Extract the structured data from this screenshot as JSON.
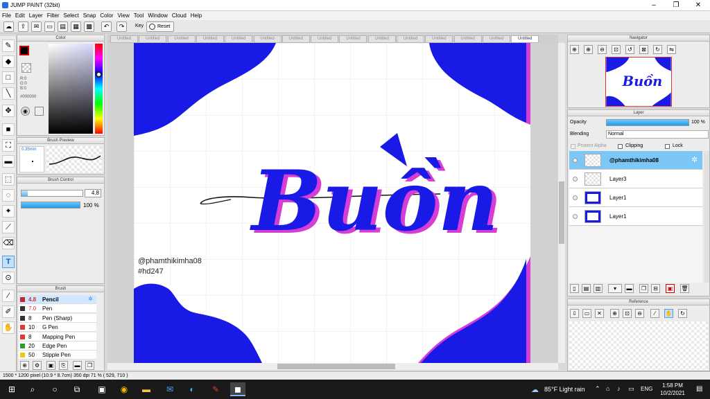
{
  "window": {
    "title": "JUMP PAINT (32bit)"
  },
  "menu": [
    "File",
    "Edit",
    "Layer",
    "Filter",
    "Select",
    "Snap",
    "Color",
    "View",
    "Tool",
    "Window",
    "Cloud",
    "Help"
  ],
  "toolbar": {
    "key_label": "Key",
    "reset_label": "Reset"
  },
  "tabs": [
    "Untitled",
    "Untitled",
    "Untitled",
    "Untitled",
    "Untitled",
    "Untitled",
    "Untitled",
    "Untitled",
    "Untitled",
    "Untitled",
    "Untitled",
    "Untitled",
    "Untitled",
    "Untitled",
    "Untitled"
  ],
  "color_panel": {
    "title": "Color",
    "r": "R:0",
    "g": "G:0",
    "b": "B:0",
    "hex": "#000000"
  },
  "brush_preview": {
    "title": "Brush Preview",
    "size": "0.35mm"
  },
  "brush_control": {
    "title": "Brush Control",
    "size_value": "4.8",
    "opacity_value": "100 %",
    "opacity_fraction": 1.0,
    "size_fraction": 0.1
  },
  "brush_panel": {
    "title": "Brush",
    "items": [
      {
        "size": "4.8",
        "name": "Pencil",
        "color": "#c62828",
        "selected": true
      },
      {
        "size": "7.0",
        "name": "Pen",
        "color": "#333333"
      },
      {
        "size": "8",
        "name": "Pen (Sharp)",
        "color": "#333333"
      },
      {
        "size": "10",
        "name": "G Pen",
        "color": "#e53935"
      },
      {
        "size": "8",
        "name": "Mapping Pen",
        "color": "#e53935"
      },
      {
        "size": "20",
        "name": "Edge Pen",
        "color": "#2e9e2e"
      },
      {
        "size": "50",
        "name": "Stipple Pen",
        "color": "#e8c81a"
      }
    ]
  },
  "artwork": {
    "title_text": "Buồn",
    "watermark1": "@phamthikimha08",
    "watermark2": "#hd247",
    "accent": "#1a1ae6",
    "shadow": "#d63cd6"
  },
  "navigator": {
    "title": "Navigator"
  },
  "layer_panel": {
    "title": "Layer",
    "opacity_label": "Opacity",
    "opacity_value": "100 %",
    "blending_label": "Blending",
    "blending_value": "Normal",
    "protect_alpha": "Protect Alpha",
    "clipping": "Clipping",
    "lock": "Lock",
    "layers": [
      {
        "name": "@phamthikimha08",
        "selected": true
      },
      {
        "name": "Layer3"
      },
      {
        "name": "Layer1"
      },
      {
        "name": "Layer1"
      }
    ]
  },
  "reference": {
    "title": "Reference"
  },
  "status": {
    "text": "1500 * 1200 pixel   (10.9 * 8.7cm)   350 dpi   71 %   ( 529, 710 )"
  },
  "taskbar": {
    "weather": "85°F  Light rain",
    "lang": "ENG",
    "time": "1:58 PM",
    "date": "10/2/2021"
  }
}
